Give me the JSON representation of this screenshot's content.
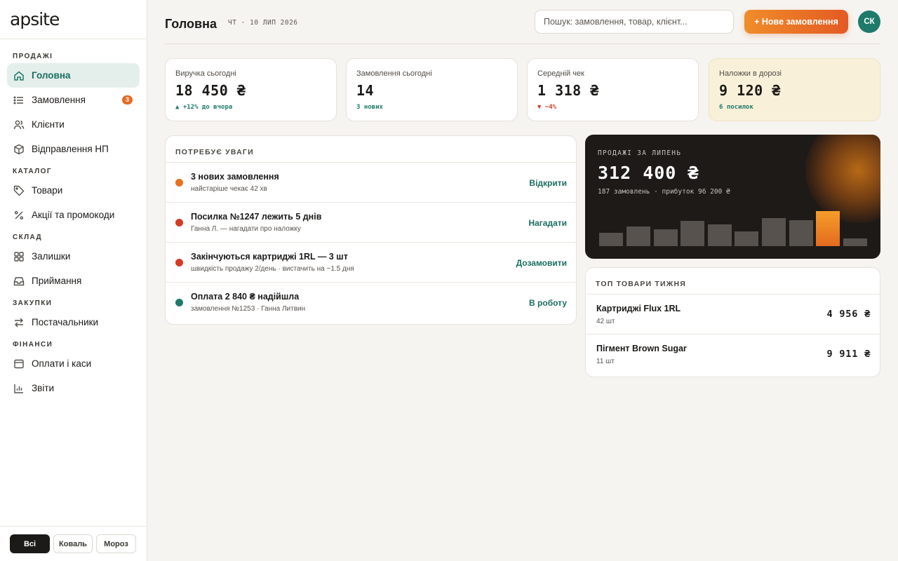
{
  "app": {
    "logo_main": "ap",
    "logo_small": "site"
  },
  "sidebar": {
    "sections": [
      {
        "label": "ПРОДАЖІ",
        "items": [
          {
            "label": "Головна",
            "icon": "home-icon",
            "active": true
          },
          {
            "label": "Замовлення",
            "icon": "list-icon",
            "badge": "3"
          },
          {
            "label": "Клієнти",
            "icon": "users-icon"
          },
          {
            "label": "Відправлення НП",
            "icon": "box-icon"
          }
        ]
      },
      {
        "label": "КАТАЛОГ",
        "items": [
          {
            "label": "Товари",
            "icon": "tag-icon"
          },
          {
            "label": "Акції та промокоди",
            "icon": "percent-icon"
          }
        ]
      },
      {
        "label": "СКЛАД",
        "items": [
          {
            "label": "Залишки",
            "icon": "grid-icon"
          },
          {
            "label": "Приймання",
            "icon": "inbox-icon"
          }
        ]
      },
      {
        "label": "ЗАКУПКИ",
        "items": [
          {
            "label": "Постачальники",
            "icon": "swap-icon"
          }
        ]
      },
      {
        "label": "ФІНАНСИ",
        "items": [
          {
            "label": "Оплати і каси",
            "icon": "wallet-icon"
          },
          {
            "label": "Звіти",
            "icon": "chart-icon"
          }
        ]
      }
    ],
    "footer": {
      "all": "Всі",
      "koval": "Коваль",
      "moroz": "Мороз"
    }
  },
  "header": {
    "title": "Головна",
    "date": "ЧТ · 10 ЛИП 2026",
    "search_placeholder": "Пошук: замовлення, товар, клієнт...",
    "new_order": "+ Нове замовлення",
    "avatar": "СК"
  },
  "stats": [
    {
      "label": "Виручка сьогодні",
      "value": "18 450 ₴",
      "sub": "▲ +12% до вчора",
      "trend": "up"
    },
    {
      "label": "Замовлення сьогодні",
      "value": "14",
      "sub": "3 нових",
      "trend": "up"
    },
    {
      "label": "Середній чек",
      "value": "1 318 ₴",
      "sub": "▼ −4%",
      "trend": "down"
    },
    {
      "label": "Наложки в дорозі",
      "value": "9 120 ₴",
      "sub": "6 посилок",
      "trend": "up"
    }
  ],
  "attention": {
    "title": "ПОТРЕБУЄ УВАГИ",
    "items": [
      {
        "title": "3 нових замовлення",
        "desc": "найстаріше чекає 42 хв",
        "action": "Відкрити",
        "color": "#e8701f"
      },
      {
        "title": "Посилка №1247 лежить 5 днів",
        "desc": "Ганна Л. — нагадати про наложку",
        "action": "Нагадати",
        "color": "#d63a26"
      },
      {
        "title": "Закінчуються картриджі 1RL — 3 шт",
        "desc": "швидкість продажу 2/день · вистачить на ~1.5 дня",
        "action": "Дозамовити",
        "color": "#d63a26"
      },
      {
        "title": "Оплата 2 840 ₴ надійшла",
        "desc": "замовлення №1253 · Ганна Литвин",
        "action": "В роботу",
        "color": "#1e7a6a"
      }
    ]
  },
  "sales": {
    "label": "ПРОДАЖІ ЗА ЛИПЕНЬ",
    "value": "312 400 ₴",
    "sub": "187 замовлень · прибуток 96 200 ₴",
    "bars": [
      0.33,
      0.48,
      0.4,
      0.61,
      0.53,
      0.36,
      0.68,
      0.62,
      0.85,
      0.19
    ],
    "highlight_index": 8,
    "bar_color": "#57524d",
    "highlight_color": "#f08a25"
  },
  "top_products": {
    "title": "ТОП ТОВАРИ ТИЖНЯ",
    "items": [
      {
        "name": "Картриджі Flux 1RL",
        "qty": "42 шт",
        "sum": "4 956 ₴"
      },
      {
        "name": "Пігмент Brown Sugar",
        "qty": "11 шт",
        "sum": "9 911 ₴"
      }
    ]
  }
}
